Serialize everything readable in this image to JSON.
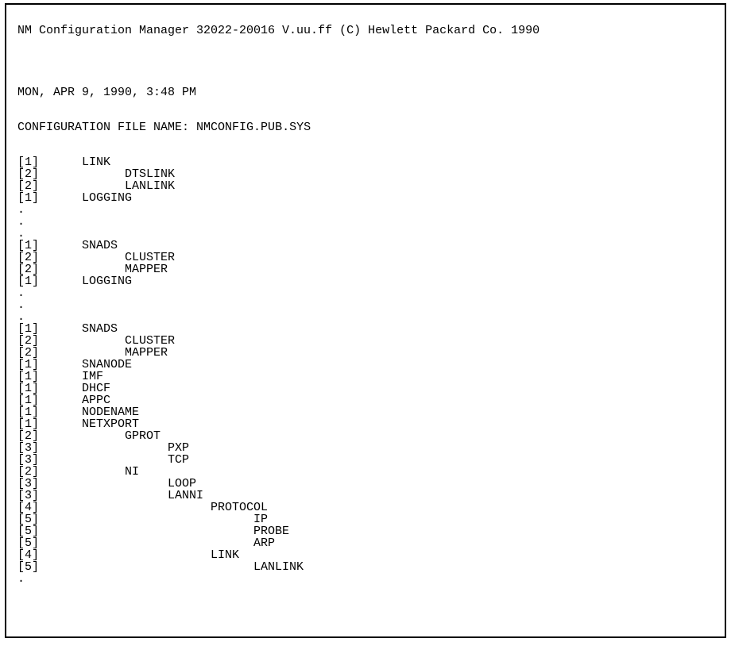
{
  "header": "NM Configuration Manager 32022-20016 V.uu.ff (C) Hewlett Packard Co. 1990",
  "datetime": "MON, APR 9, 1990, 3:48 PM",
  "config_label": "CONFIGURATION FILE NAME: ",
  "config_file": "NMCONFIG.PUB.SYS",
  "rows": [
    {
      "num": "[1]",
      "indent": 1,
      "label": "LINK"
    },
    {
      "num": "[2]",
      "indent": 2,
      "label": "DTSLINK"
    },
    {
      "num": "[2]",
      "indent": 2,
      "label": "LANLINK"
    },
    {
      "num": "[1]",
      "indent": 1,
      "label": "LOGGING"
    },
    {
      "dot": true
    },
    {
      "dot": true
    },
    {
      "dot": true
    },
    {
      "num": "[1]",
      "indent": 1,
      "label": "SNADS"
    },
    {
      "num": "[2]",
      "indent": 2,
      "label": "CLUSTER"
    },
    {
      "num": "[2]",
      "indent": 2,
      "label": "MAPPER"
    },
    {
      "num": "[1]",
      "indent": 1,
      "label": "LOGGING"
    },
    {
      "dot": true
    },
    {
      "dot": true
    },
    {
      "dot": true
    },
    {
      "num": "[1]",
      "indent": 1,
      "label": "SNADS"
    },
    {
      "num": "[2]",
      "indent": 2,
      "label": "CLUSTER"
    },
    {
      "num": "[2]",
      "indent": 2,
      "label": "MAPPER"
    },
    {
      "num": "[1]",
      "indent": 1,
      "label": "SNANODE"
    },
    {
      "num": "[1]",
      "indent": 1,
      "label": "IMF"
    },
    {
      "num": "[1]",
      "indent": 1,
      "label": "DHCF"
    },
    {
      "num": "[1]",
      "indent": 1,
      "label": "APPC"
    },
    {
      "num": "[1]",
      "indent": 1,
      "label": "NODENAME"
    },
    {
      "num": "[1]",
      "indent": 1,
      "label": "NETXPORT"
    },
    {
      "num": "[2]",
      "indent": 2,
      "label": "GPROT"
    },
    {
      "num": "[3]",
      "indent": 3,
      "label": "PXP"
    },
    {
      "num": "[3]",
      "indent": 3,
      "label": "TCP"
    },
    {
      "num": "[2]",
      "indent": 2,
      "label": "NI"
    },
    {
      "num": "[3]",
      "indent": 3,
      "label": "LOOP"
    },
    {
      "num": "[3]",
      "indent": 3,
      "label": "LANNI"
    },
    {
      "num": "[4]",
      "indent": 4,
      "label": "PROTOCOL"
    },
    {
      "num": "[5]",
      "indent": 5,
      "label": "IP"
    },
    {
      "num": "[5]",
      "indent": 5,
      "label": "PROBE"
    },
    {
      "num": "[5]",
      "indent": 5,
      "label": "ARP"
    },
    {
      "num": "[4]",
      "indent": 4,
      "label": "LINK"
    },
    {
      "num": "[5]",
      "indent": 5,
      "label": "LANLINK"
    },
    {
      "dot": true
    }
  ],
  "dot_char": "."
}
